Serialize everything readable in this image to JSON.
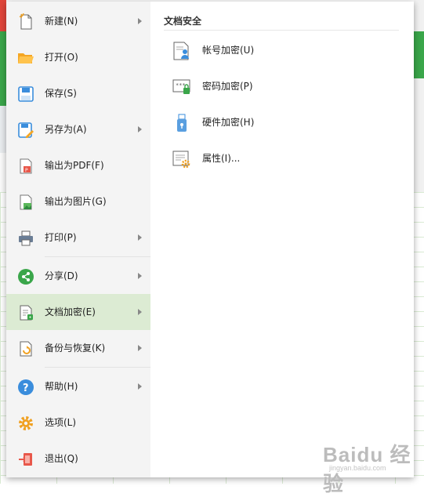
{
  "menu": {
    "items": [
      {
        "label": "新建(N)",
        "icon": "new-file-icon",
        "submenu": true
      },
      {
        "label": "打开(O)",
        "icon": "open-folder-icon",
        "submenu": false
      },
      {
        "label": "保存(S)",
        "icon": "save-icon",
        "submenu": false
      },
      {
        "label": "另存为(A)",
        "icon": "save-as-icon",
        "submenu": true
      },
      {
        "label": "输出为PDF(F)",
        "icon": "pdf-export-icon",
        "submenu": false
      },
      {
        "label": "输出为图片(G)",
        "icon": "image-export-icon",
        "submenu": false
      },
      {
        "label": "打印(P)",
        "icon": "printer-icon",
        "submenu": true
      },
      {
        "label": "分享(D)",
        "icon": "share-icon",
        "submenu": true
      },
      {
        "label": "文档加密(E)",
        "icon": "document-lock-icon",
        "submenu": true,
        "active": true
      },
      {
        "label": "备份与恢复(K)",
        "icon": "backup-restore-icon",
        "submenu": true
      },
      {
        "label": "帮助(H)",
        "icon": "help-icon",
        "submenu": true
      },
      {
        "label": "选项(L)",
        "icon": "gear-icon",
        "submenu": false
      },
      {
        "label": "退出(Q)",
        "icon": "exit-icon",
        "submenu": false
      }
    ]
  },
  "submenu": {
    "title": "文档安全",
    "items": [
      {
        "label": "帐号加密(U)",
        "icon": "account-encrypt-icon"
      },
      {
        "label": "密码加密(P)",
        "icon": "password-encrypt-icon"
      },
      {
        "label": "硬件加密(H)",
        "icon": "usb-key-icon"
      },
      {
        "label": "属性(I)...",
        "icon": "properties-icon"
      }
    ]
  },
  "watermark": {
    "text": "Baidu 经验",
    "sub": "jingyan.baidu.com"
  },
  "colors": {
    "active_bg": "#dcebd3",
    "panel_bg": "#f4f4f4",
    "accent_green": "#3aa64a"
  }
}
